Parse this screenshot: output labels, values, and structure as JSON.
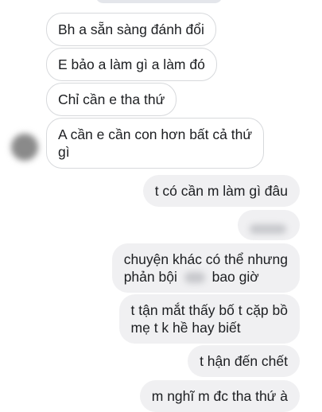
{
  "conversation": {
    "incoming": [
      {
        "text": "Bh a sẵn sàng đánh đổi"
      },
      {
        "text": "E bảo a làm gì a làm đó"
      },
      {
        "text": "Chỉ cần e tha thứ"
      },
      {
        "lines": [
          "A cần e cần con hơn bất cả thứ",
          "gì"
        ]
      }
    ],
    "outgoing": [
      {
        "text": "t có cần m làm gì đâu"
      },
      {
        "redacted": true
      },
      {
        "lines": [
          "chuyện khác có thể nhưng",
          "phản bội",
          "bao giờ"
        ],
        "redacted_between": "phản bội"
      },
      {
        "lines": [
          "t tận mắt thấy bố t cặp bồ",
          "mẹ t k hề hay biết"
        ]
      },
      {
        "text": "t hận đến chết"
      },
      {
        "text": "m nghĩ m đc tha thứ à"
      }
    ]
  },
  "colors": {
    "incoming_bg": "#ffffff",
    "incoming_border": "#d7d9dc",
    "outgoing_bg": "#f0f0f2",
    "text": "#1c1e21"
  }
}
